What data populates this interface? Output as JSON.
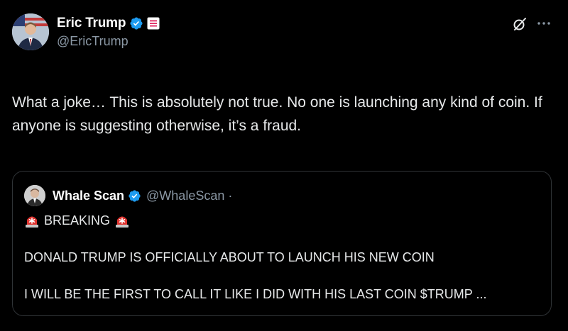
{
  "author": {
    "display_name": "Eric Trump",
    "handle": "@EricTrump",
    "avatar_icon": "profile-photo",
    "verified_color": "#1d9bf0"
  },
  "tweet": {
    "text": "What a joke… This is absolutely not true. No one is launching any kind of coin. If anyone is suggesting otherwise, it’s a fraud."
  },
  "quoted": {
    "display_name": "Whale Scan",
    "handle": "@WhaleScan ·",
    "breaking_label": "BREAKING",
    "line1": "DONALD TRUMP IS OFFICIALLY ABOUT TO LAUNCH HIS NEW COIN",
    "line2": "I WILL BE THE FIRST TO CALL IT LIKE I DID WITH HIS LAST COIN $TRUMP ..."
  },
  "icons": {
    "grok": "grok-icon",
    "more": "more-icon",
    "siren": "siren-icon"
  },
  "colors": {
    "background": "#000000",
    "text": "#e7e9ea",
    "secondary": "#8b98a5",
    "border": "#2f3336",
    "verified": "#1d9bf0"
  }
}
